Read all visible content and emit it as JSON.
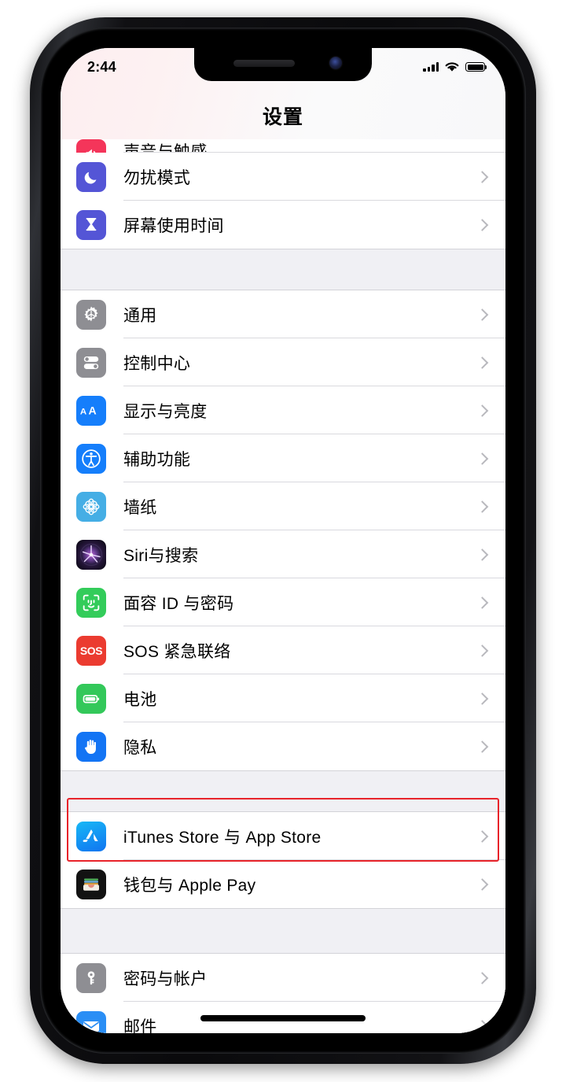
{
  "device": {
    "name": "iPhone X",
    "frame_color": "#101013",
    "buttons": [
      "mute-switch",
      "volume-up",
      "volume-down",
      "power"
    ]
  },
  "status_bar": {
    "time": "2:44",
    "signal_icon": "cellular-bars-icon",
    "signal_bars": 4,
    "wifi_icon": "wifi-icon",
    "battery_icon": "battery-icon",
    "battery_level": 100
  },
  "header": {
    "title": "设置"
  },
  "highlight": {
    "target": "iTunes Store 与 App Store",
    "color": "#e8232a"
  },
  "groups": [
    {
      "id": "group-notifications",
      "rows": [
        {
          "id": "sounds",
          "label": "声音与触感",
          "icon": "sounds-icon",
          "icon_class": "ic-sounds",
          "clipped": true
        },
        {
          "id": "do-not-disturb",
          "label": "勿扰模式",
          "icon": "moon-icon",
          "icon_class": "ic-dnd"
        },
        {
          "id": "screen-time",
          "label": "屏幕使用时间",
          "icon": "hourglass-icon",
          "icon_class": "ic-screentime",
          "last": true
        }
      ]
    },
    {
      "id": "group-system",
      "rows": [
        {
          "id": "general",
          "label": "通用",
          "icon": "gear-icon",
          "icon_class": "ic-general"
        },
        {
          "id": "control-center",
          "label": "控制中心",
          "icon": "toggles-icon",
          "icon_class": "ic-control"
        },
        {
          "id": "display-brightness",
          "label": "显示与亮度",
          "icon": "aa-text-icon",
          "icon_class": "ic-display"
        },
        {
          "id": "accessibility",
          "label": "辅助功能",
          "icon": "accessibility-icon",
          "icon_class": "ic-access"
        },
        {
          "id": "wallpaper",
          "label": "墙纸",
          "icon": "flower-icon",
          "icon_class": "ic-wallpaper"
        },
        {
          "id": "siri-search",
          "label": "Siri与搜索",
          "icon": "siri-icon",
          "icon_class": "ic-siri"
        },
        {
          "id": "face-id",
          "label": "面容 ID 与密码",
          "icon": "face-id-icon",
          "icon_class": "ic-faceid"
        },
        {
          "id": "emergency-sos",
          "label": "SOS 紧急联络",
          "icon": "sos-icon",
          "icon_class": "ic-sos",
          "icon_text": "SOS"
        },
        {
          "id": "battery",
          "label": "电池",
          "icon": "battery-icon",
          "icon_class": "ic-battery"
        },
        {
          "id": "privacy",
          "label": "隐私",
          "icon": "hand-icon",
          "icon_class": "ic-privacy",
          "last": true
        }
      ]
    },
    {
      "id": "group-store",
      "rows": [
        {
          "id": "itunes-app-store",
          "label": "iTunes Store 与 App Store",
          "icon": "app-store-icon",
          "icon_class": "ic-appstore"
        },
        {
          "id": "wallet-apple-pay",
          "label": "钱包与 Apple Pay",
          "icon": "wallet-icon",
          "icon_class": "ic-wallet",
          "last": true
        }
      ]
    },
    {
      "id": "group-accounts",
      "rows": [
        {
          "id": "passwords-accounts",
          "label": "密码与帐户",
          "icon": "key-icon",
          "icon_class": "ic-passwords"
        },
        {
          "id": "mail",
          "label": "邮件",
          "icon": "mail-icon",
          "icon_class": "ic-mail",
          "last": true
        }
      ]
    }
  ]
}
